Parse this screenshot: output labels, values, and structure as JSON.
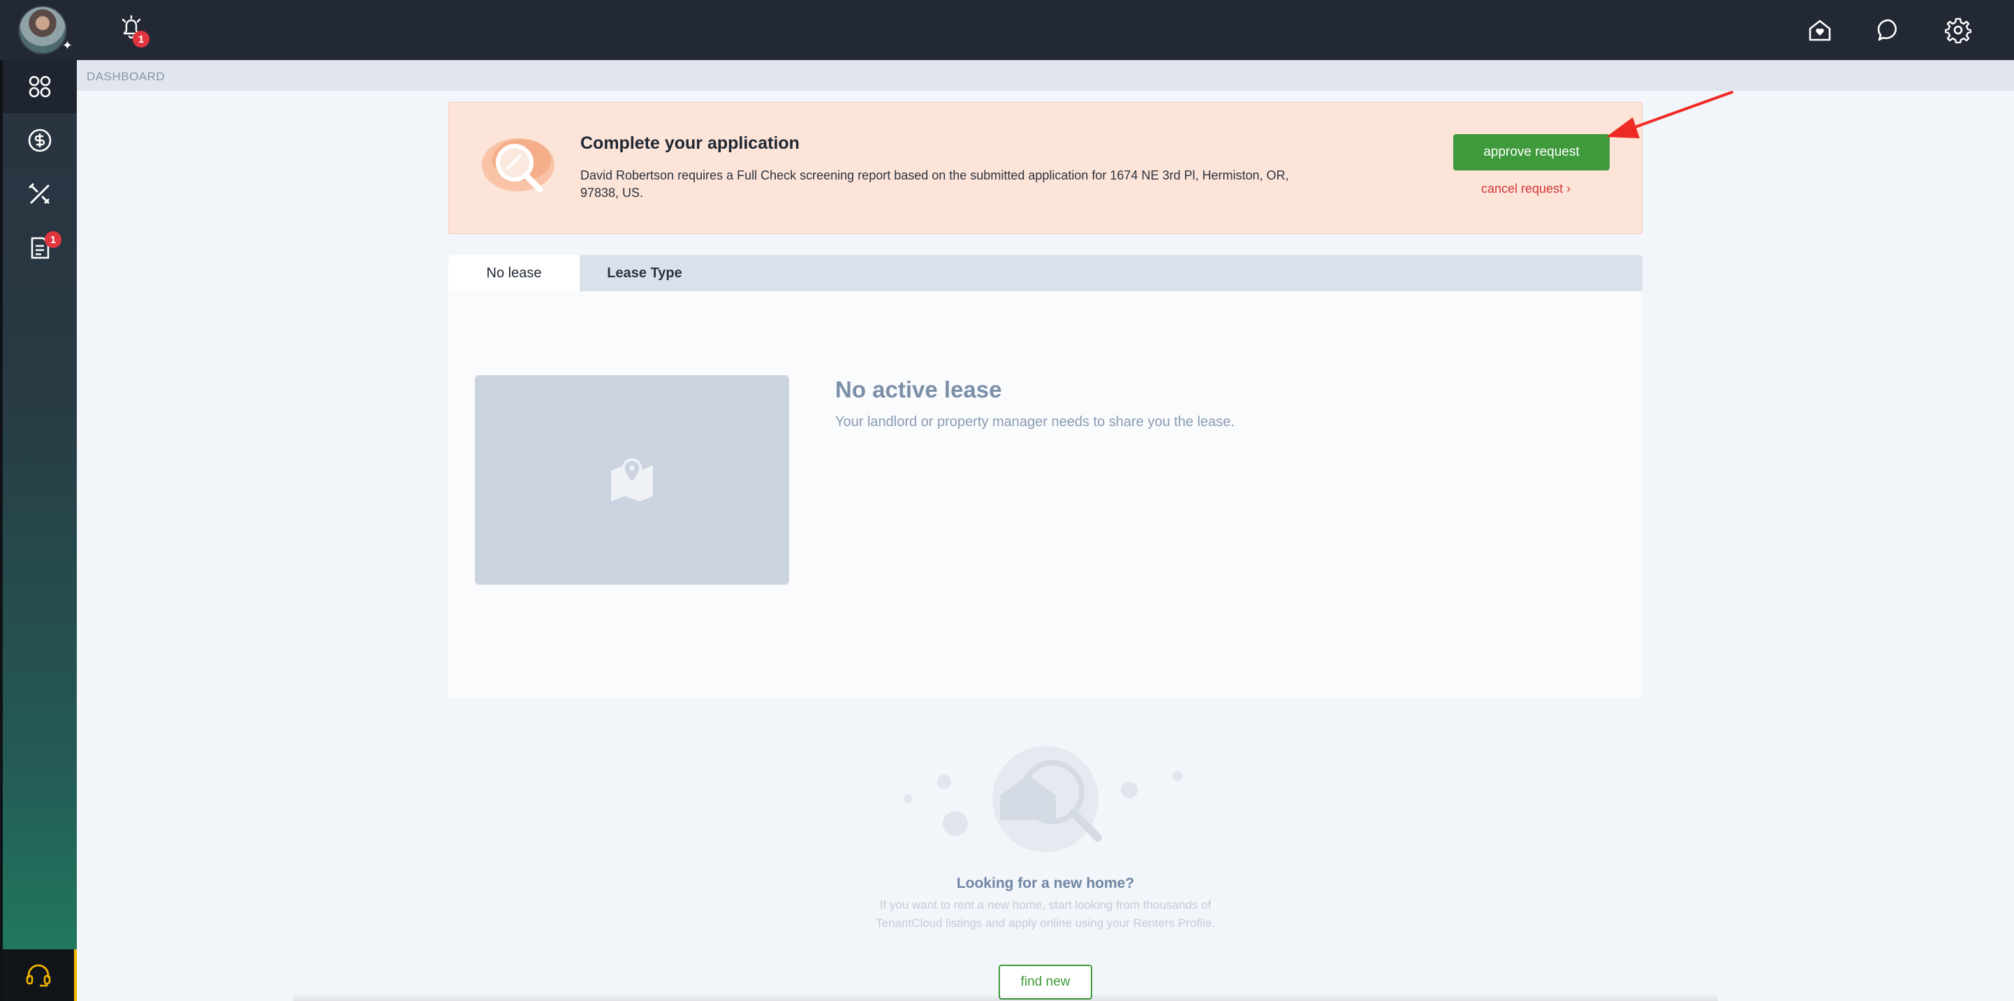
{
  "topbar": {
    "notification_count": "1",
    "icons": [
      "bell-icon",
      "home-heart-icon",
      "chat-icon",
      "gear-icon"
    ]
  },
  "sidebar": {
    "items": [
      {
        "name": "dashboard",
        "icon": "grid-icon",
        "active": true
      },
      {
        "name": "payments",
        "icon": "dollar-icon",
        "active": false
      },
      {
        "name": "maintenance",
        "icon": "tools-icon",
        "active": false
      },
      {
        "name": "documents",
        "icon": "document-icon",
        "active": false,
        "badge": "1"
      }
    ],
    "support_icon": "headset-icon"
  },
  "breadcrumb": "DASHBOARD",
  "alert": {
    "title": "Complete your application",
    "text": "David Robertson requires a Full Check screening report based on the submitted application for 1674 NE 3rd Pl, Hermiston, OR, 97838, US.",
    "approve_label": "approve request",
    "cancel_label": "cancel request ›"
  },
  "tabs": [
    {
      "label": "No lease",
      "active": true
    },
    {
      "label": "Lease Type",
      "active": false
    }
  ],
  "lease": {
    "title": "No active lease",
    "subtitle": "Your landlord or property manager needs to share you the lease."
  },
  "find_home": {
    "title": "Looking for a new home?",
    "text": "If you want to rent a new home, start looking from thousands of TenantCloud listings and apply online using your Renters Profile.",
    "button_label": "find new"
  },
  "colors": {
    "topbar": "#222834",
    "accent_green": "#3f9a3b",
    "alert_bg": "#fde4d8",
    "danger": "#d03939",
    "badge": "#e0343f"
  }
}
